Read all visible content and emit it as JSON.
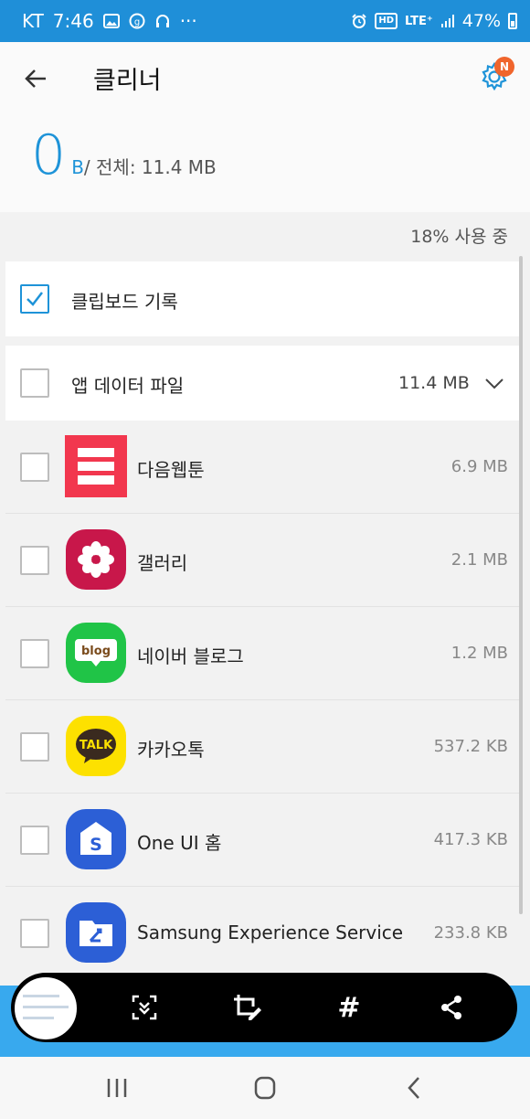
{
  "status_bar": {
    "carrier": "KT",
    "time": "7:46",
    "more": "···",
    "hd": "HD",
    "lte": "LTE⁺",
    "battery": "47%"
  },
  "header": {
    "title": "클리너",
    "badge": "N",
    "size_value": "0",
    "size_unit": "B",
    "total_text": "/ 전체: 11.4 MB"
  },
  "usage_text": "18% 사용 중",
  "rows": {
    "clipboard": {
      "label": "클립보드 기록",
      "checked": true
    },
    "app_data": {
      "label": "앱 데이터 파일",
      "size": "11.4 MB",
      "checked": false
    }
  },
  "apps": [
    {
      "name": "다음웹툰",
      "size": "6.9 MB",
      "icon": "daum-webtoon-icon",
      "color": "#f2374e"
    },
    {
      "name": "갤러리",
      "size": "2.1 MB",
      "icon": "gallery-icon",
      "color": "#c8174a"
    },
    {
      "name": "네이버 블로그",
      "size": "1.2 MB",
      "icon": "naver-blog-icon",
      "color": "#20c447",
      "icon_text": "blog"
    },
    {
      "name": "카카오톡",
      "size": "537.2 KB",
      "icon": "kakaotalk-icon",
      "color": "#fde100",
      "icon_text": "TALK"
    },
    {
      "name": "One UI 홈",
      "size": "417.3 KB",
      "icon": "one-ui-home-icon",
      "color": "#2c5fd6",
      "icon_text": "S"
    },
    {
      "name": "Samsung Experience Service",
      "size": "233.8 KB",
      "icon": "samsung-experience-icon",
      "color": "#2c5fd6"
    }
  ],
  "toolbar": {
    "hashtag": "#"
  },
  "colors": {
    "accent": "#1e93d8",
    "status_bar": "#1f8fd8"
  }
}
